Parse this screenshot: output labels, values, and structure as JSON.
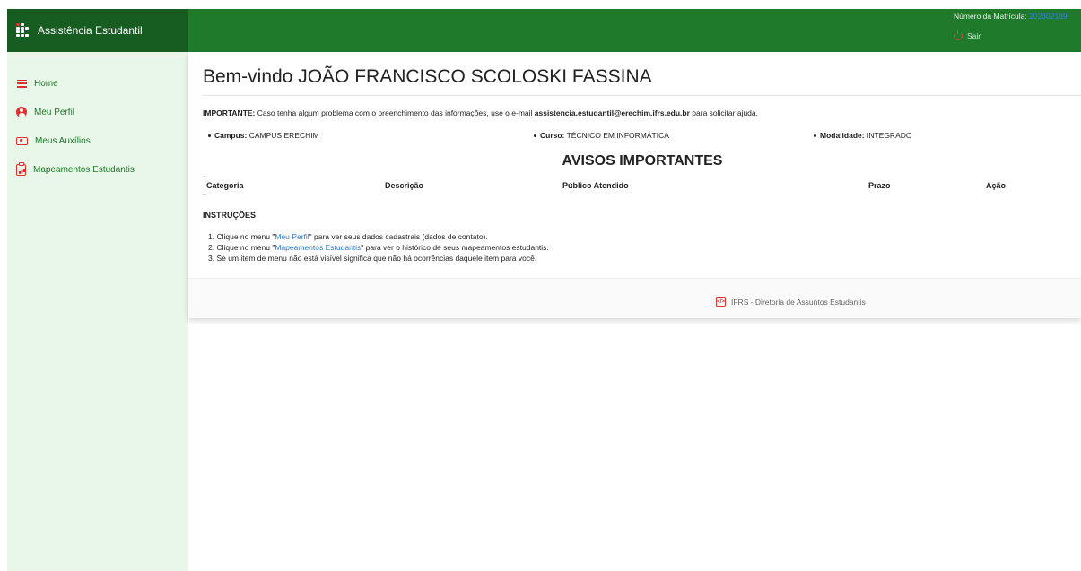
{
  "header": {
    "brand_title": "Assistência Estudantil",
    "matricula_label": "Número da Matrícula:",
    "matricula_value": "202302189",
    "logout_label": "Sair"
  },
  "sidebar": {
    "items": [
      {
        "label": "Home",
        "icon": "menu-icon"
      },
      {
        "label": "Meu Perfil",
        "icon": "user-circle-icon"
      },
      {
        "label": "Meus Auxílios",
        "icon": "money-icon"
      },
      {
        "label": "Mapeamentos Estudantis",
        "icon": "clipboard-chart-icon"
      }
    ]
  },
  "main": {
    "welcome": "Bem-vindo JOÃO FRANCISCO SCOLOSKI FASSINA",
    "important_label": "IMPORTANTE:",
    "important_text": " Caso tenha algum problema com o preenchimento das informações, use o e-mail ",
    "important_email": "assistencia.estudantil@erechim.ifrs.edu.br",
    "important_suffix": " para solicitar ajuda.",
    "campus_label": "Campus:",
    "campus_value": " CAMPUS ERECHIM",
    "curso_label": "Curso:",
    "curso_value": " TÉCNICO EM INFORMÁTICA",
    "modalidade_label": "Modalidade:",
    "modalidade_value": " INTEGRADO",
    "avisos_title": "AVISOS IMPORTANTES",
    "table_headers": [
      "Categoria",
      "Descrição",
      "Público Atendido",
      "Prazo",
      "Ação"
    ],
    "instructions_title": "INSTRUÇÕES",
    "instructions": [
      {
        "prefix": "1. Clique no menu \"",
        "link": "Meu Perfil",
        "suffix": "\" para ver seus dados cadastrais (dados de contato)."
      },
      {
        "prefix": "2. Clique no menu \"",
        "link": "Mapeamentos Estudantis",
        "suffix": "\" para ver o histórico de seus mapeamentos estudantis."
      },
      {
        "prefix": "3. Se um item de menu não está visível significa que não há ocorrências daquele item para você.",
        "link": "",
        "suffix": ""
      }
    ],
    "footer_text": "IFRS - Diretoria de Assuntos Estudantis"
  },
  "colors": {
    "topbar": "#1f7a2c",
    "brand_bg": "#175d21",
    "sidebar_bg": "#e8f7e8",
    "accent_red": "#e03030",
    "link_blue": "#2a7bd6"
  }
}
